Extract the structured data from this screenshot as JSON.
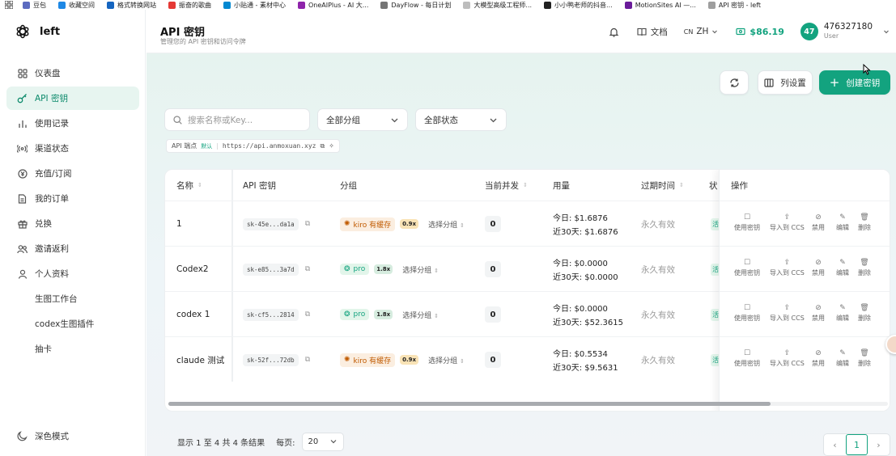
{
  "bookmarks": [
    {
      "label": "豆包",
      "color": "#5c6bc0"
    },
    {
      "label": "收藏空间",
      "color": "#1e88e5"
    },
    {
      "label": "格式转换网站",
      "color": "#1565c0"
    },
    {
      "label": "振奋的歌曲",
      "color": "#e53935"
    },
    {
      "label": "小贴通 - 素材中心",
      "color": "#0288d1"
    },
    {
      "label": "OneAIPlus - AI 大...",
      "color": "#8e24aa"
    },
    {
      "label": "DayFlow - 每日计划",
      "color": "#757575"
    },
    {
      "label": "大模型高级工程师...",
      "color": "#bdbdbd"
    },
    {
      "label": "小小鸭老师的抖音...",
      "color": "#212121"
    },
    {
      "label": "MotionSites AI —...",
      "color": "#6a1b9a"
    },
    {
      "label": "API 密钥 - left",
      "color": "#9e9e9e"
    }
  ],
  "app": {
    "name": "left"
  },
  "sidebar": {
    "items": [
      {
        "label": "仪表盘"
      },
      {
        "label": "API 密钥"
      },
      {
        "label": "使用记录"
      },
      {
        "label": "渠道状态"
      },
      {
        "label": "充值/订阅"
      },
      {
        "label": "我的订单"
      },
      {
        "label": "兑换"
      },
      {
        "label": "邀请返利"
      },
      {
        "label": "个人资料"
      },
      {
        "label": "生图工作台"
      },
      {
        "label": "codex生图插件"
      },
      {
        "label": "抽卡"
      }
    ],
    "dark_mode": "深色模式"
  },
  "header": {
    "title": "API 密钥",
    "subtitle": "管理您的 API 密钥和访问令牌",
    "docs": "文档",
    "lang_prefix": "CN",
    "lang": "ZH",
    "balance": "$86.19",
    "avatar": "47",
    "user_id": "476327180",
    "user_role": "User"
  },
  "toolbar": {
    "columns_label": "列设置",
    "create_label": "创建密钥"
  },
  "filters": {
    "search_placeholder": "搜索名称或Key...",
    "group": "全部分组",
    "status": "全部状态"
  },
  "endpoint": {
    "label": "API 端点",
    "tag": "默认",
    "url": "https://api.anmoxuan.xyz"
  },
  "table": {
    "headers": {
      "name": "名称",
      "key": "API 密钥",
      "group": "分组",
      "concurrency": "当前并发",
      "usage": "用量",
      "expiry": "过期时间",
      "status": "状",
      "ops": "操作"
    },
    "select_group": "选择分组",
    "status_stub": "活",
    "rows": [
      {
        "name": "1",
        "key": "sk-45e...da1a",
        "group": "kiro 有缓存",
        "group_color": "#fbeee0",
        "group_text": "#c05a00",
        "group_icon": "✺",
        "mult": "0.9x",
        "mult_bg": "#f9e3b6",
        "concurrency": "0",
        "today": "今日: $1.6876",
        "month": "近30天: $1.6876",
        "expiry": "永久有效"
      },
      {
        "name": "Codex2",
        "key": "sk-e85...3a7d",
        "group": "pro",
        "group_color": "#e2f5ea",
        "group_text": "#13a37f",
        "group_icon": "❂",
        "mult": "1.8x",
        "mult_bg": "#d6ecdf",
        "concurrency": "0",
        "today": "今日: $0.0000",
        "month": "近30天: $0.0000",
        "expiry": "永久有效"
      },
      {
        "name": "codex 1",
        "key": "sk-cf5...2814",
        "group": "pro",
        "group_color": "#e2f5ea",
        "group_text": "#13a37f",
        "group_icon": "❂",
        "mult": "1.8x",
        "mult_bg": "#d6ecdf",
        "concurrency": "0",
        "today": "今日: $0.0000",
        "month": "近30天: $52.3615",
        "expiry": "永久有效"
      },
      {
        "name": "claude 测试",
        "key": "sk-52f...72db",
        "group": "kiro 有缓存",
        "group_color": "#fbeee0",
        "group_text": "#c05a00",
        "group_icon": "✺",
        "mult": "0.9x",
        "mult_bg": "#f9e3b6",
        "concurrency": "0",
        "today": "今日: $0.5534",
        "month": "近30天: $9.5631",
        "expiry": "永久有效"
      }
    ],
    "ops": [
      "使用密钥",
      "导入到 CCS",
      "禁用",
      "编辑",
      "删除"
    ]
  },
  "footer": {
    "summary": "显示 1 至 4 共 4 条结果",
    "per_page_label": "每页:",
    "per_page": "20",
    "current_page": "1"
  },
  "colors": {
    "accent": "#13a37f"
  }
}
